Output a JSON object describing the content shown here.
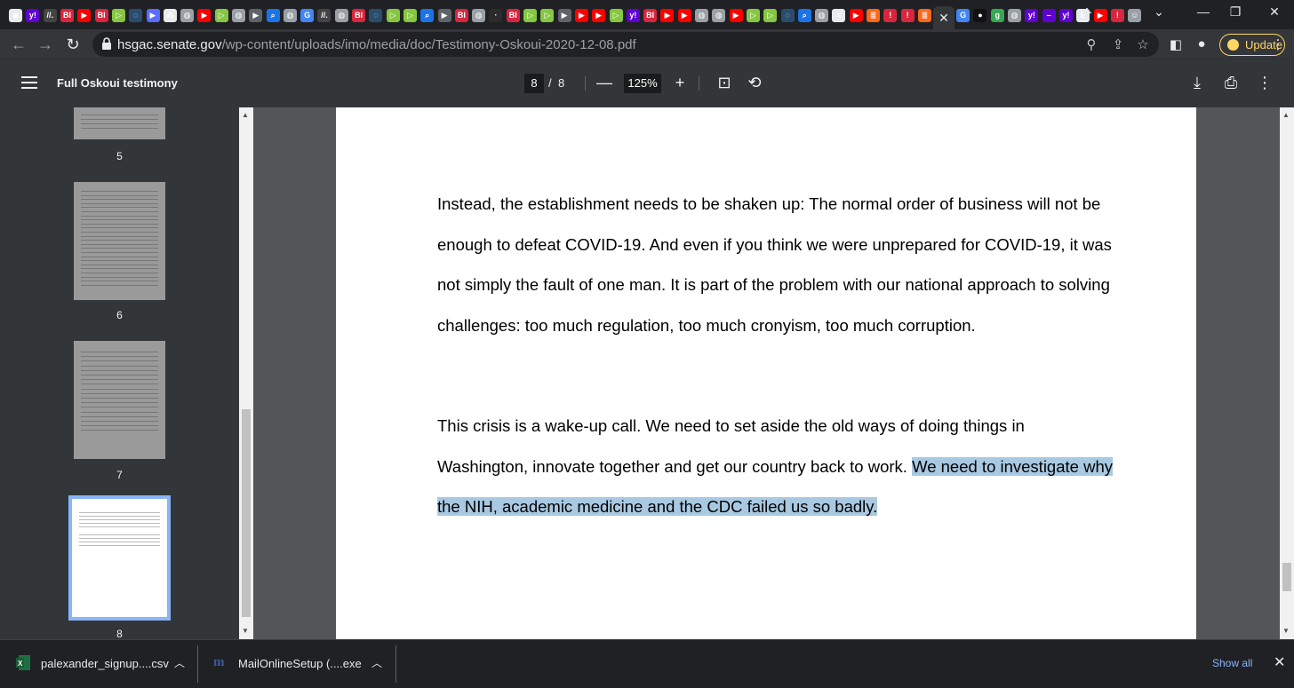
{
  "browser": {
    "tab_favicons": [
      {
        "icon": "github-icon",
        "color": "#e8eaed",
        "glyph": "◉"
      },
      {
        "icon": "yahoo-icon",
        "color": "#6001d2",
        "glyph": "y!"
      },
      {
        "icon": "generic-site-icon",
        "color": "#444",
        "glyph": "//."
      },
      {
        "icon": "bi-icon",
        "color": "#d7263d",
        "glyph": "BI"
      },
      {
        "icon": "youtube-icon",
        "color": "#ff0000",
        "glyph": "▶"
      },
      {
        "icon": "bi-icon",
        "color": "#d7263d",
        "glyph": "BI"
      },
      {
        "icon": "rumble-icon",
        "color": "#85c742",
        "glyph": "▷"
      },
      {
        "icon": "shield-icon",
        "color": "#2a4d6e",
        "glyph": "◌"
      },
      {
        "icon": "stream-icon",
        "color": "#5b6cff",
        "glyph": "▶"
      },
      {
        "icon": "puzzle-icon",
        "color": "#e8eaed",
        "glyph": "⁂"
      },
      {
        "icon": "globe-icon",
        "color": "#9aa0a6",
        "glyph": "◍"
      },
      {
        "icon": "youtube-icon",
        "color": "#ff0000",
        "glyph": "▶"
      },
      {
        "icon": "rumble-icon",
        "color": "#85c742",
        "glyph": "▷"
      },
      {
        "icon": "globe-icon",
        "color": "#9aa0a6",
        "glyph": "◍"
      },
      {
        "icon": "stream-icon",
        "color": "#5f6368",
        "glyph": "▶"
      },
      {
        "icon": "search-icon",
        "color": "#1a73e8",
        "glyph": "⌕"
      },
      {
        "icon": "globe-icon",
        "color": "#9aa0a6",
        "glyph": "◍"
      },
      {
        "icon": "google-icon",
        "color": "#4285f4",
        "glyph": "G"
      },
      {
        "icon": "generic-site-icon",
        "color": "#444",
        "glyph": "//."
      },
      {
        "icon": "globe-icon",
        "color": "#9aa0a6",
        "glyph": "◍"
      },
      {
        "icon": "bi-icon",
        "color": "#d7263d",
        "glyph": "BI"
      },
      {
        "icon": "shield-icon",
        "color": "#2a4d6e",
        "glyph": "◌"
      },
      {
        "icon": "rumble-icon",
        "color": "#85c742",
        "glyph": "▷"
      },
      {
        "icon": "rumble-icon",
        "color": "#85c742",
        "glyph": "▷"
      },
      {
        "icon": "search-icon",
        "color": "#1a73e8",
        "glyph": "⌕"
      },
      {
        "icon": "stream-icon",
        "color": "#5f6368",
        "glyph": "▶"
      },
      {
        "icon": "bi-icon",
        "color": "#d7263d",
        "glyph": "BI"
      },
      {
        "icon": "globe-icon",
        "color": "#9aa0a6",
        "glyph": "◍"
      },
      {
        "icon": "generic-site-icon",
        "color": "#2b2b2b",
        "glyph": "·"
      },
      {
        "icon": "bi-icon",
        "color": "#d7263d",
        "glyph": "BI"
      },
      {
        "icon": "rumble-icon",
        "color": "#85c742",
        "glyph": "▷"
      },
      {
        "icon": "rumble-icon",
        "color": "#85c742",
        "glyph": "▷"
      },
      {
        "icon": "stream-icon",
        "color": "#5f6368",
        "glyph": "▶"
      },
      {
        "icon": "youtube-icon",
        "color": "#ff0000",
        "glyph": "▶"
      },
      {
        "icon": "youtube-icon",
        "color": "#ff0000",
        "glyph": "▶"
      },
      {
        "icon": "rumble-icon",
        "color": "#85c742",
        "glyph": "▷"
      },
      {
        "icon": "yahoo-icon",
        "color": "#6001d2",
        "glyph": "y!"
      },
      {
        "icon": "bi-icon",
        "color": "#d7263d",
        "glyph": "BI"
      },
      {
        "icon": "youtube-icon",
        "color": "#ff0000",
        "glyph": "▶"
      },
      {
        "icon": "youtube-icon",
        "color": "#ff0000",
        "glyph": "▶"
      },
      {
        "icon": "globe-icon",
        "color": "#9aa0a6",
        "glyph": "◍"
      },
      {
        "icon": "globe-icon",
        "color": "#9aa0a6",
        "glyph": "◍"
      },
      {
        "icon": "youtube-icon",
        "color": "#ff0000",
        "glyph": "▶"
      },
      {
        "icon": "rumble-icon",
        "color": "#85c742",
        "glyph": "▷"
      },
      {
        "icon": "rumble-icon",
        "color": "#85c742",
        "glyph": "▷"
      },
      {
        "icon": "shield-icon",
        "color": "#2a4d6e",
        "glyph": "◌"
      },
      {
        "icon": "search-icon",
        "color": "#1a73e8",
        "glyph": "⌕"
      },
      {
        "icon": "globe-icon",
        "color": "#9aa0a6",
        "glyph": "◍"
      },
      {
        "icon": "news-icon",
        "color": "#e8eaed",
        "glyph": "≡"
      },
      {
        "icon": "youtube-icon",
        "color": "#ff0000",
        "glyph": "▶"
      },
      {
        "icon": "substack-icon",
        "color": "#ff6719",
        "glyph": "≣"
      },
      {
        "icon": "alert-icon",
        "color": "#d7263d",
        "glyph": "!"
      },
      {
        "icon": "alert-icon",
        "color": "#d7263d",
        "glyph": "!"
      },
      {
        "icon": "substack-icon",
        "color": "#ff6719",
        "glyph": "≣"
      }
    ],
    "active_tab_close": "✕",
    "tab_favicons_after": [
      {
        "icon": "google-icon",
        "color": "#4285f4",
        "glyph": "G"
      },
      {
        "icon": "dark-site-icon",
        "color": "#111",
        "glyph": "●"
      },
      {
        "icon": "g-icon",
        "color": "#34a853",
        "glyph": "g"
      },
      {
        "icon": "globe-icon",
        "color": "#9aa0a6",
        "glyph": "◍"
      },
      {
        "icon": "yahoo-icon",
        "color": "#6001d2",
        "glyph": "y!"
      },
      {
        "icon": "minus-site-icon",
        "color": "#6001d2",
        "glyph": "–"
      },
      {
        "icon": "yahoo-icon",
        "color": "#6001d2",
        "glyph": "y!"
      },
      {
        "icon": "book-icon",
        "color": "#e8eaed",
        "glyph": "E"
      },
      {
        "icon": "youtube-icon",
        "color": "#ff0000",
        "glyph": "▶"
      },
      {
        "icon": "alert-icon",
        "color": "#d7263d",
        "glyph": "!"
      },
      {
        "icon": "person-icon",
        "color": "#9aa0a6",
        "glyph": "☺"
      }
    ],
    "new_tab": "+",
    "url_host": "hsgac.senate.gov",
    "url_path": "/wp-content/uploads/imo/media/doc/Testimony-Oskoui-2020-12-08.pdf",
    "update_label": "Update"
  },
  "pdf": {
    "title": "Full Oskoui testimony",
    "current_page": "8",
    "page_separator": "/",
    "total_pages": "8",
    "zoom": "125%",
    "thumbnails": [
      {
        "number": "5"
      },
      {
        "number": "6"
      },
      {
        "number": "7"
      },
      {
        "number": "8"
      }
    ],
    "paragraph1": "Instead, the establishment needs to be shaken up: The normal order of business will not be enough to defeat COVID-19. And even if you think we were unprepared for COVID-19, it was not simply the fault of one man. It is part of the problem with our national approach to solving challenges: too much regulation, too much cronyism, too much corruption.",
    "paragraph2_plain": "This crisis is a wake-up call. We need to set aside the old ways of doing things in Washington, innovate together and get our country back to work.",
    "paragraph2_highlighted": "We need to investigate why the NIH, academic medicine and the CDC failed us so badly."
  },
  "downloads": {
    "items": [
      {
        "name": "palexander_signup....csv",
        "icon": "excel-icon"
      },
      {
        "name": "MailOnlineSetup (....exe",
        "icon": "mailonline-icon"
      }
    ],
    "show_all": "Show all"
  }
}
